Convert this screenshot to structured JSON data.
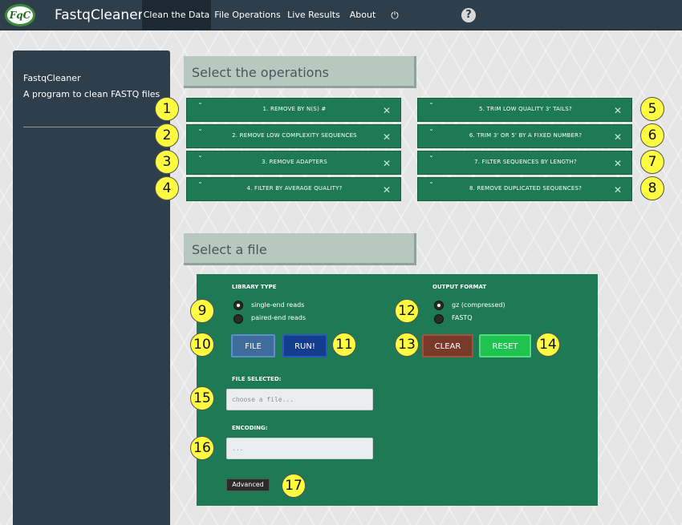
{
  "app": {
    "logo_text": "FqC",
    "brand": "FastqCleaner"
  },
  "nav": {
    "items": [
      "Clean the Data",
      "File Operations",
      "Live Results",
      "About"
    ],
    "power_icon": "⏻",
    "help_icon": "?"
  },
  "sidebar": {
    "title": "FastqCleaner",
    "subtitle": "A program to clean FASTQ files"
  },
  "operations": {
    "heading": "Select the operations",
    "left": [
      "1. REMOVE BY N(S) #",
      "2. REMOVE LOW COMPLEXITY SEQUENCES",
      "3. REMOVE ADAPTERS",
      "4. FILTER BY AVERAGE QUALITY?"
    ],
    "right": [
      "5. TRIM LOW QUALITY 3' TAILS?",
      "6. TRIM 3' OR 5' BY A FIXED NUMBER?",
      "7. FILTER SEQUENCES BY LENGTH?",
      "8. REMOVE DUPLICATED SEQUENCES?"
    ],
    "chevron": "ˇ",
    "close": "✕"
  },
  "file_section": {
    "heading": "Select a file",
    "library_type_label": "LIBRARY TYPE",
    "library_options": [
      "single-end reads",
      "paired-end reads"
    ],
    "library_selected": 0,
    "output_format_label": "OUTPUT FORMAT",
    "output_options": [
      "gz (compressed)",
      "FASTQ"
    ],
    "output_selected": 0,
    "buttons": {
      "file": "FILE",
      "run": "RUN!",
      "clear": "CLEAR",
      "reset": "RESET"
    },
    "file_selected_label": "FILE SELECTED:",
    "file_placeholder": "choose a file...",
    "encoding_label": "ENCODING:",
    "encoding_placeholder": "...",
    "advanced_button": "Advanced"
  },
  "callouts": [
    "1",
    "2",
    "3",
    "4",
    "5",
    "6",
    "7",
    "8",
    "9",
    "10",
    "11",
    "12",
    "13",
    "14",
    "15",
    "16",
    "17"
  ],
  "colors": {
    "navbar": "#2f3e4b",
    "panel_green": "#1d7a55",
    "callout_yellow": "#fffb40"
  }
}
